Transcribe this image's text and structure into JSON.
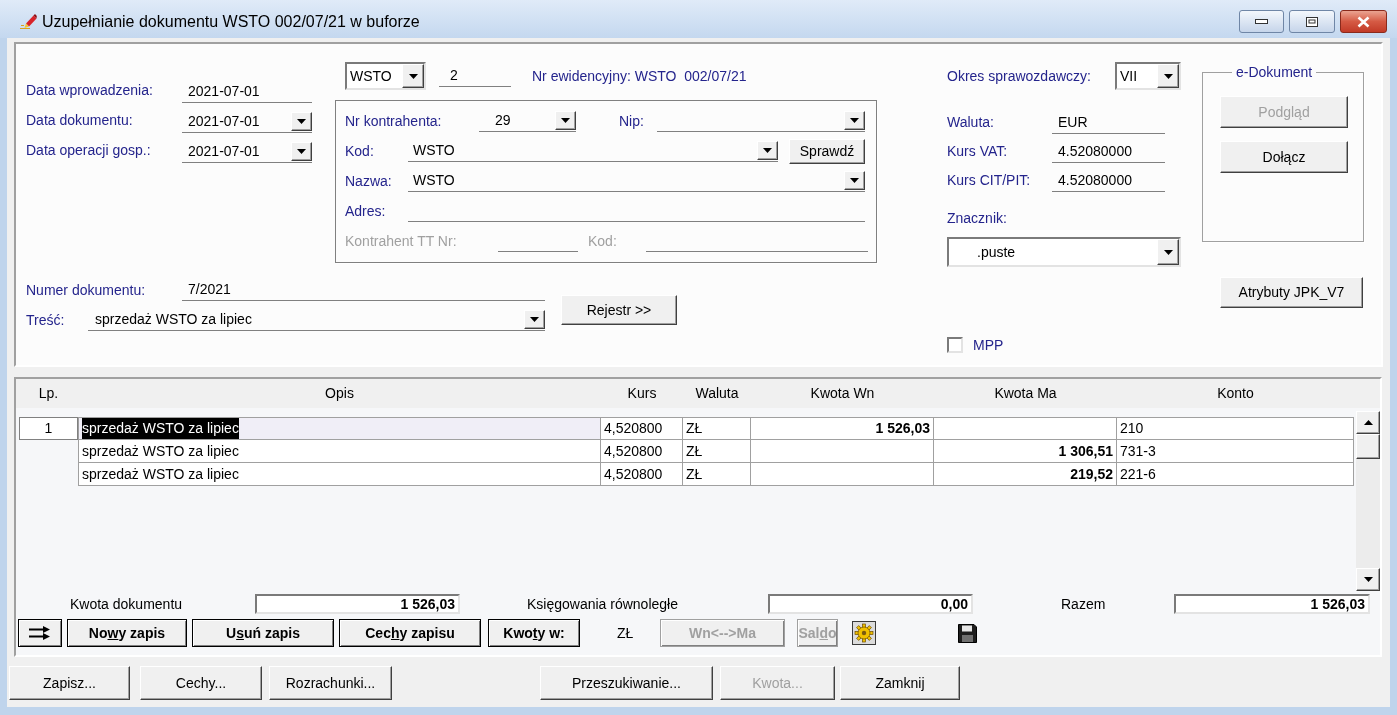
{
  "window": {
    "title": "Uzupełnianie dokumentu WSTO 002/07/21 w buforze"
  },
  "dates": [
    {
      "label": "Data wprowadzenia:",
      "value": "2021-07-01",
      "kind": "text"
    },
    {
      "label": "Data dokumentu:",
      "value": "2021-07-01",
      "kind": "dropdown"
    },
    {
      "label": "Data operacji gosp.:",
      "value": "2021-07-01",
      "kind": "dropdown"
    }
  ],
  "journal": {
    "code": "WSTO",
    "number": "2",
    "registry_number": "Nr ewidencyjny: WSTO  002/07/21"
  },
  "contractor": {
    "number": {
      "label": "Nr kontrahenta:",
      "value": "29"
    },
    "nip": {
      "label": "Nip:"
    },
    "code": {
      "label": "Kod:",
      "value": "WSTO"
    },
    "check_button": "Sprawdź",
    "name": {
      "label": "Nazwa:",
      "value": "WSTO"
    },
    "address": {
      "label": "Adres:"
    },
    "tt_number": {
      "label": "Kontrahent TT Nr:",
      "disabled": true
    },
    "tt_code": {
      "label": "Kod:",
      "disabled": true
    }
  },
  "document_number": {
    "label": "Numer dokumentu:",
    "value": "7/2021"
  },
  "content": {
    "label": "Treść:",
    "value": "sprzedaż WSTO za lipiec"
  },
  "register_button": "Rejestr >>",
  "reporting_period": {
    "label": "Okres sprawozdawczy:",
    "value": "VII"
  },
  "currency_fields": [
    {
      "label": "Waluta:",
      "value": "EUR"
    },
    {
      "label": "Kurs VAT:",
      "value": "4.52080000"
    },
    {
      "label": "Kurs CIT/PIT:",
      "value": "4.52080000"
    }
  ],
  "tag": {
    "label": "Znacznik:",
    "value": ".puste"
  },
  "mpp": {
    "label": "MPP",
    "checked": false
  },
  "e_document": {
    "title": "e-Dokument",
    "buttons": [
      {
        "label": "Podgląd",
        "disabled": true
      },
      {
        "label": "Dołącz",
        "disabled": false
      }
    ]
  },
  "jpk_button": "Atrybuty JPK_V7",
  "table": {
    "columns": [
      "Lp.",
      "Opis",
      "Kurs",
      "Waluta",
      "Kwota Wn",
      "Kwota Ma",
      "Konto"
    ],
    "rows": [
      {
        "lp": "1",
        "description": "sprzedaż WSTO za lipiec",
        "rate": "4,520800",
        "currency": "ZŁ",
        "debit": "1 526,03",
        "account": "210",
        "selected": true
      },
      {
        "description": "sprzedaż WSTO za lipiec",
        "rate": "4,520800",
        "currency": "ZŁ",
        "credit": "1 306,51",
        "account": "731-3",
        "selected": false
      },
      {
        "description": "sprzedaż WSTO za lipiec",
        "rate": "4,520800",
        "currency": "ZŁ",
        "credit": "219,52",
        "account": "221-6",
        "selected": false
      }
    ]
  },
  "totals": [
    {
      "label": "Kwota dokumentu",
      "value": "1 526,03"
    },
    {
      "label": "Księgowania równoległe",
      "value": "0,00"
    },
    {
      "label": "Razem",
      "value": "1 526,03"
    }
  ],
  "entry_toolbar": [
    {
      "kind": "icon"
    },
    {
      "kind": "button",
      "label": [
        "No",
        "w",
        "y zapis"
      ],
      "disabled": false
    },
    {
      "kind": "button",
      "label": [
        "U",
        "s",
        "uń zapis"
      ],
      "disabled": false
    },
    {
      "kind": "button",
      "label": [
        "Cec",
        "h",
        "y zapisu"
      ],
      "disabled": false
    },
    {
      "kind": "button",
      "label": [
        "Kwo",
        "t",
        "y w:"
      ],
      "disabled": false
    },
    {
      "kind": "text",
      "text": "ZŁ"
    },
    {
      "kind": "button",
      "label": [
        "Wn<-->Ma"
      ],
      "disabled": true
    },
    {
      "kind": "button",
      "label": [
        "Sal",
        "d",
        "o"
      ],
      "disabled": true
    },
    {
      "kind": "icon"
    },
    {
      "kind": "icon"
    }
  ],
  "bottom_buttons": [
    [
      {
        "label": "Zapisz...",
        "disabled": false
      },
      {
        "label": "Cechy...",
        "disabled": false
      },
      {
        "label": "Rozrachunki...",
        "disabled": false
      }
    ],
    [
      {
        "label": "Przeszukiwanie...",
        "disabled": false
      },
      {
        "label": "Kwota...",
        "disabled": true
      },
      {
        "label": "Zamknij",
        "disabled": false
      }
    ]
  ]
}
